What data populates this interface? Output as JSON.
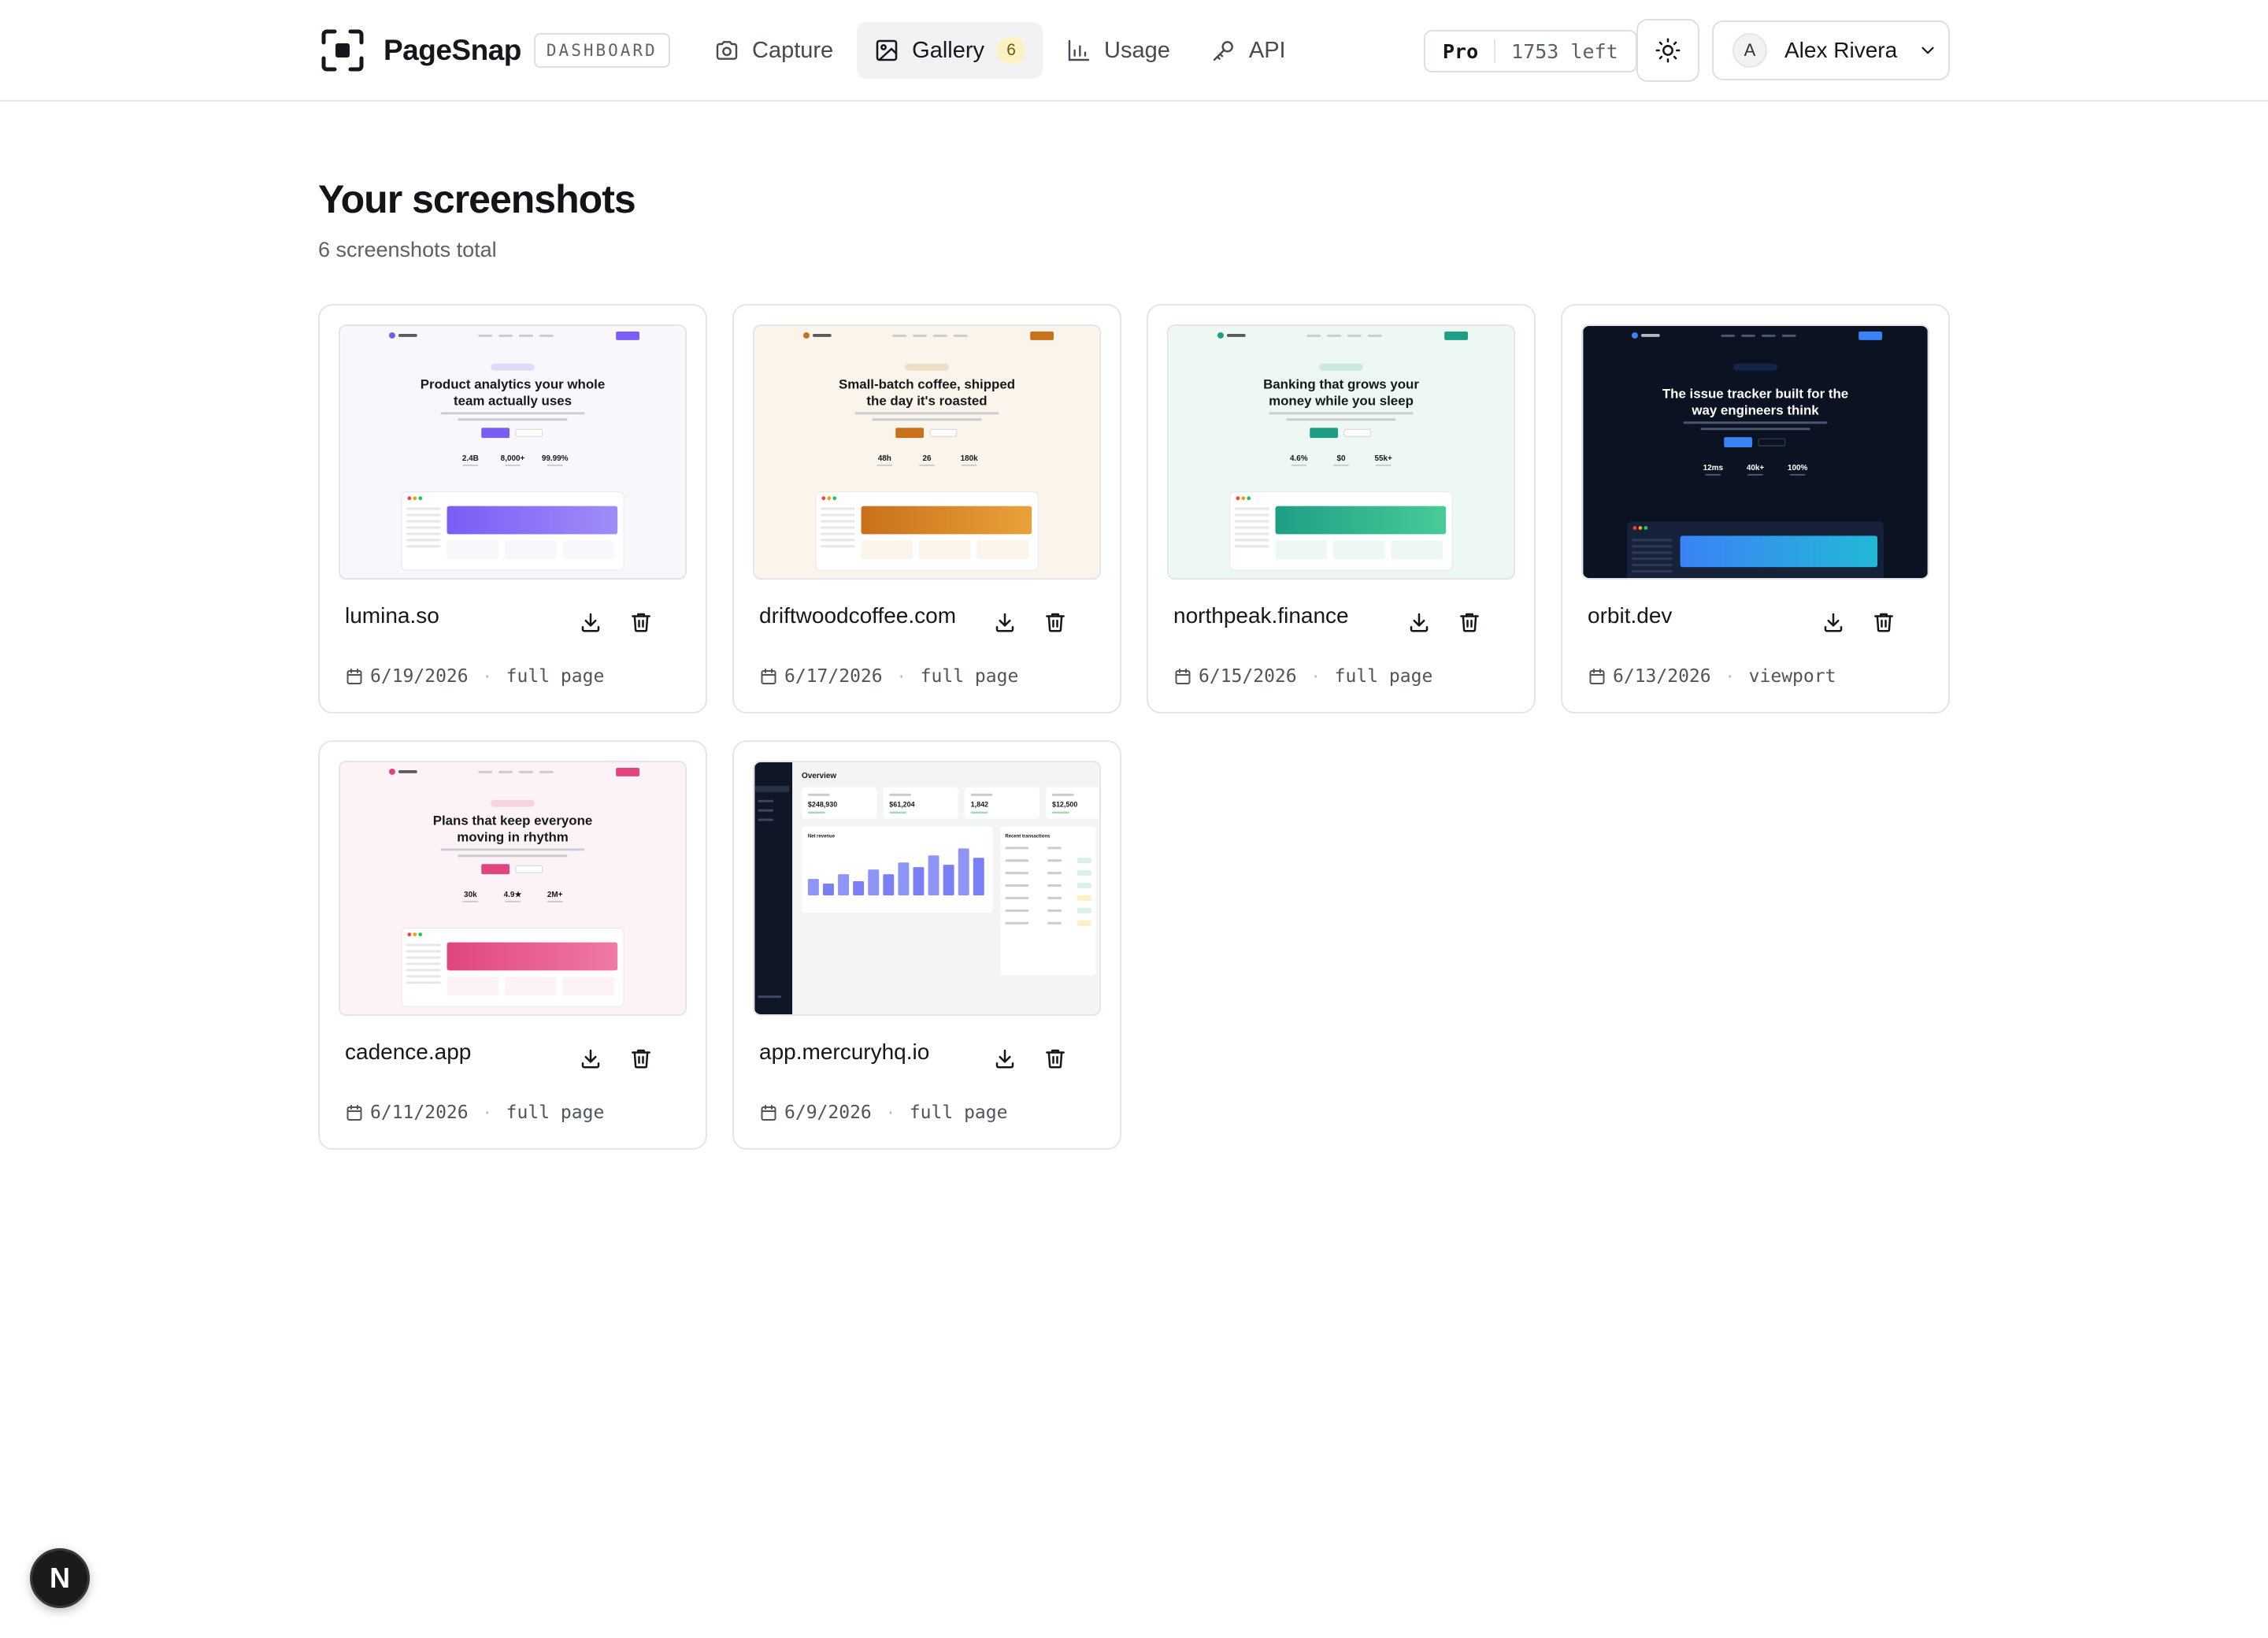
{
  "brand": {
    "name": "PageSnap",
    "badge": "DASHBOARD"
  },
  "nav": [
    {
      "id": "capture",
      "label": "Capture",
      "icon": "camera-icon",
      "active": false
    },
    {
      "id": "gallery",
      "label": "Gallery",
      "icon": "image-icon",
      "active": true,
      "count": "6"
    },
    {
      "id": "usage",
      "label": "Usage",
      "icon": "bar-chart-icon",
      "active": false
    },
    {
      "id": "api",
      "label": "API",
      "icon": "key-icon",
      "active": false
    }
  ],
  "plan": {
    "name": "Pro",
    "remaining": "1753 left"
  },
  "user": {
    "initial": "A",
    "name": "Alex Rivera"
  },
  "page": {
    "title": "Your screenshots",
    "subtitle": "6 screenshots total"
  },
  "screenshots": [
    {
      "domain": "lumina.so",
      "date": "6/19/2026",
      "mode": "full page",
      "preview": {
        "headline1": "Product analytics your whole",
        "headline2": "team actually uses",
        "stat1": "2.4B",
        "stat2": "8,000+",
        "stat3": "99.99%",
        "bg": "#f7f7fc",
        "accent": "#7b5cf5",
        "accent2": "#a08cf7",
        "dark": false
      }
    },
    {
      "domain": "driftwoodcoffee.com",
      "date": "6/17/2026",
      "mode": "full page",
      "preview": {
        "headline1": "Small-batch coffee, shipped",
        "headline2": "the day it's roasted",
        "stat1": "48h",
        "stat2": "26",
        "stat3": "180k",
        "bg": "#faf4ea",
        "accent": "#c8711a",
        "accent2": "#e9a23b",
        "dark": false
      }
    },
    {
      "domain": "northpeak.finance",
      "date": "6/15/2026",
      "mode": "full page",
      "preview": {
        "headline1": "Banking that grows your",
        "headline2": "money while you sleep",
        "stat1": "4.6%",
        "stat2": "$0",
        "stat3": "55k+",
        "bg": "#eef8f3",
        "accent": "#1f9e86",
        "accent2": "#48cc98",
        "dark": false
      }
    },
    {
      "domain": "orbit.dev",
      "date": "6/13/2026",
      "mode": "viewport",
      "preview": {
        "headline1": "The issue tracker built for the",
        "headline2": "way engineers think",
        "stat1": "12ms",
        "stat2": "40k+",
        "stat3": "100%",
        "bg": "#0b1322",
        "accent": "#3b82f6",
        "accent2": "#22b8d6",
        "dark": true
      }
    },
    {
      "domain": "cadence.app",
      "date": "6/11/2026",
      "mode": "full page",
      "preview": {
        "headline1": "Plans that keep everyone",
        "headline2": "moving in rhythm",
        "stat1": "30k",
        "stat2": "4.9★",
        "stat3": "2M+",
        "bg": "#fdf3f6",
        "accent": "#e0457f",
        "accent2": "#f07aa6",
        "dark": false
      }
    },
    {
      "domain": "app.mercuryhq.io",
      "date": "6/9/2026",
      "mode": "full page",
      "preview": {
        "title": "Overview",
        "kpi1": "$248,930",
        "kpi2": "$61,204",
        "kpi3": "1,842",
        "kpi4": "$12,500",
        "chart_title": "Net revenue",
        "table_title": "Recent transactions",
        "bars": [
          0.35,
          0.25,
          0.45,
          0.3,
          0.55,
          0.45,
          0.7,
          0.6,
          0.85,
          0.65,
          1.0,
          0.8
        ]
      }
    }
  ]
}
